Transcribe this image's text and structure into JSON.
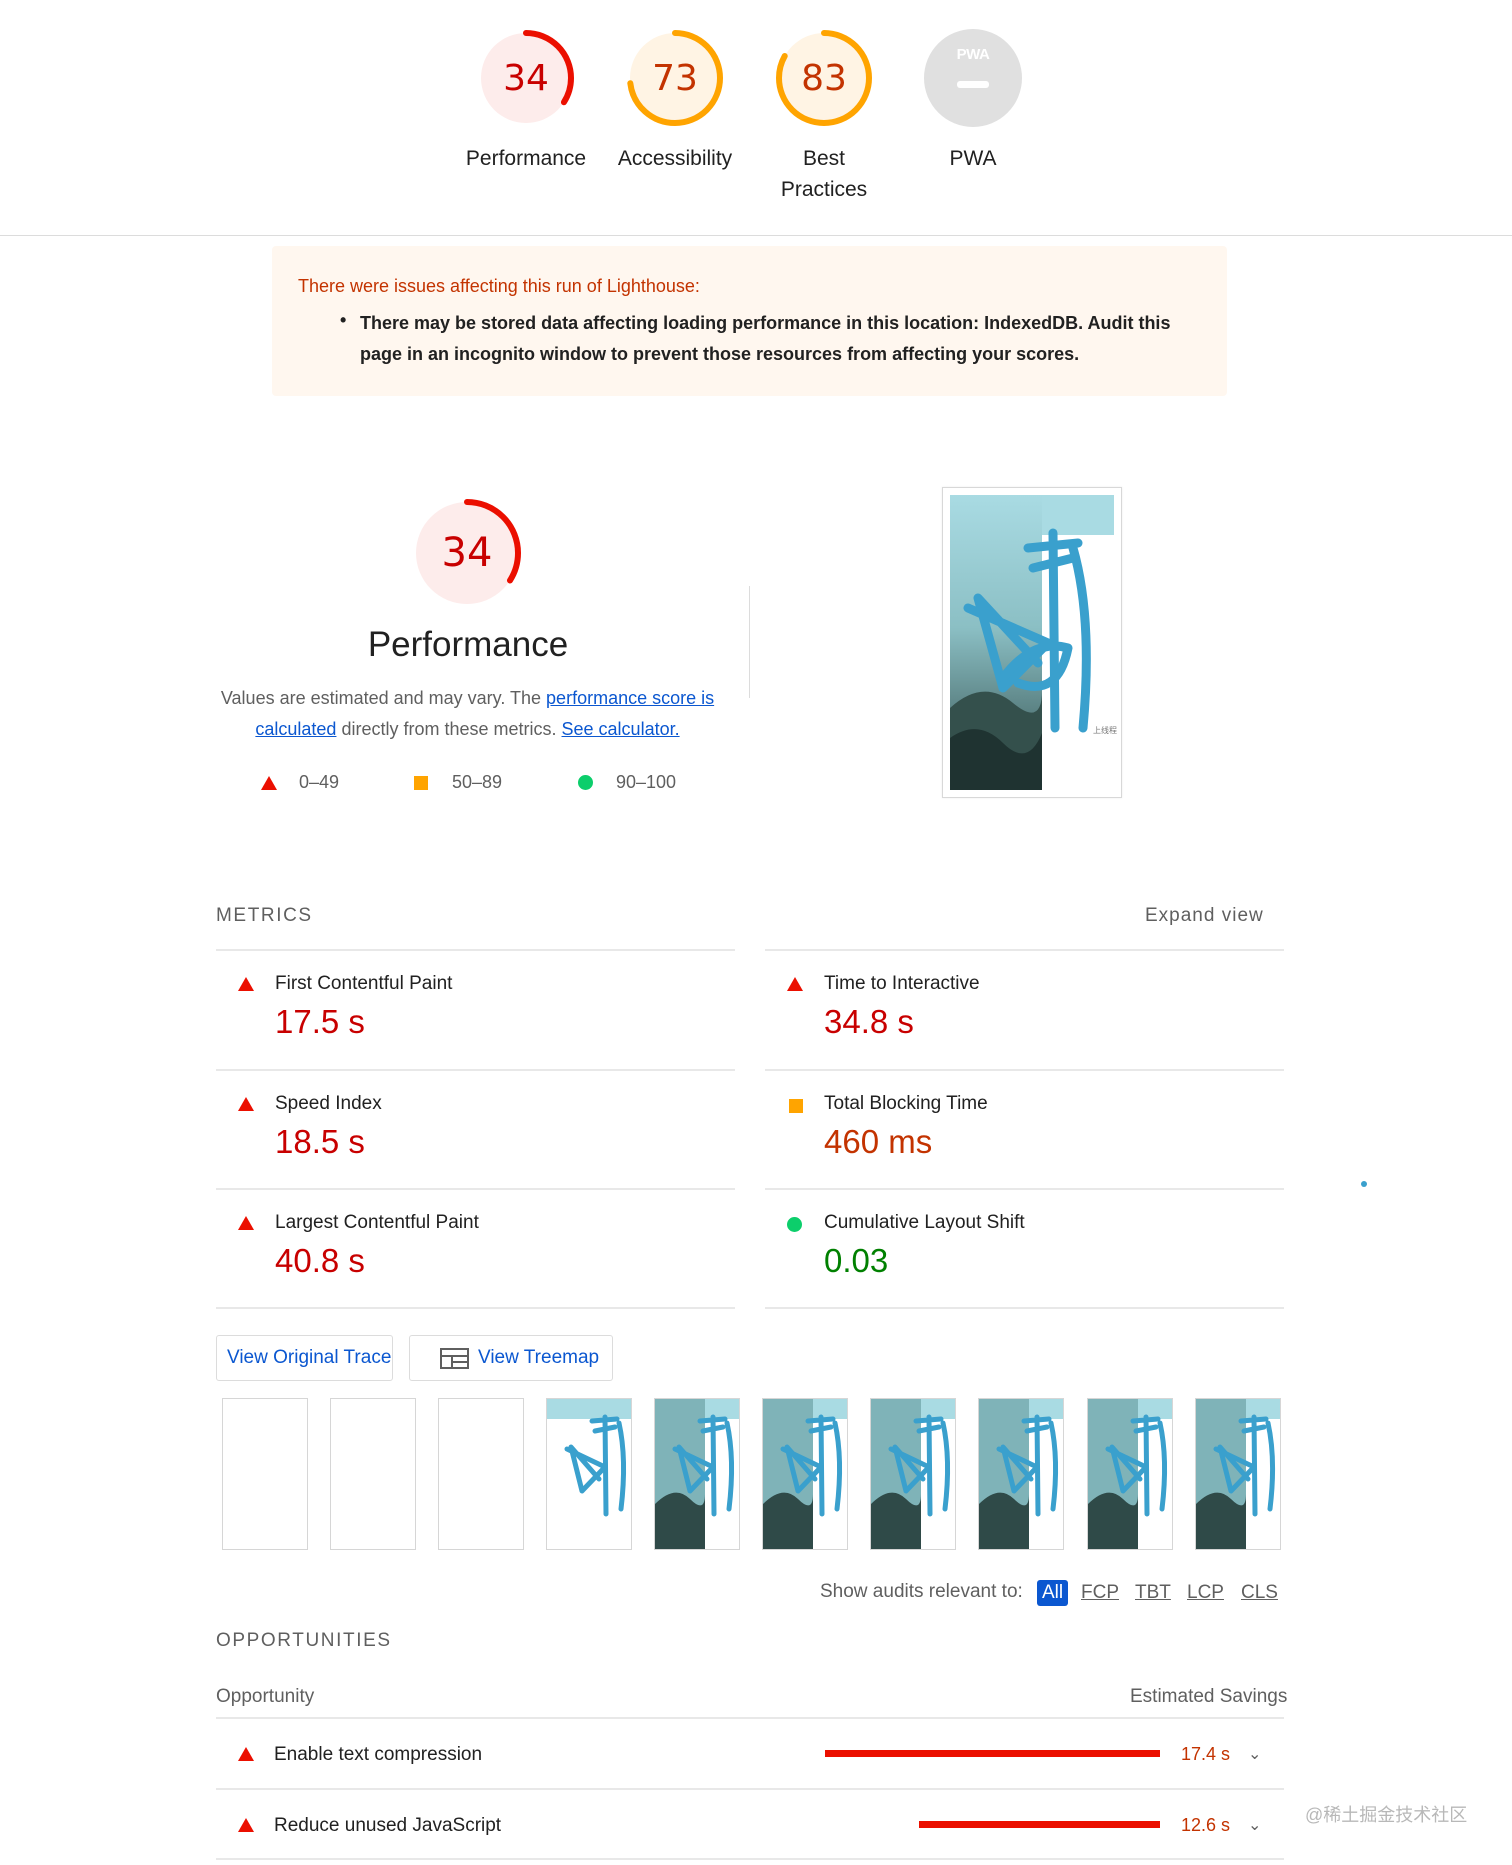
{
  "scores": [
    {
      "value": "34",
      "label": "Performance",
      "fraction": 0.34,
      "status": "fail"
    },
    {
      "value": "73",
      "label": "Accessibility",
      "fraction": 0.73,
      "status": "average"
    },
    {
      "value": "83",
      "label": "Best Practices",
      "label_line1": "Best",
      "label_line2": "Practices",
      "fraction": 0.83,
      "status": "average"
    },
    {
      "value": "",
      "label": "PWA",
      "badge": "PWA",
      "status": "na"
    }
  ],
  "colors": {
    "fail": "#eb0f00",
    "fail_text": "#c80000",
    "fail_bg": "#fdeceb",
    "average": "#ffa400",
    "average_text": "#c33300",
    "average_bg": "#fff4e4",
    "pass": "#0cce6b",
    "pass_text": "#008000",
    "link": "#0b57d0",
    "na_bg": "#e0e0e0"
  },
  "warning": {
    "title": "There were issues affecting this run of Lighthouse:",
    "item": "There may be stored data affecting loading performance in this location: IndexedDB. Audit this page in an incognito window to prevent those resources from affecting your scores."
  },
  "performance": {
    "score": "34",
    "fraction": 0.34,
    "title": "Performance",
    "desc_prefix": "Values are estimated and may vary. The ",
    "desc_link1": "performance score is calculated",
    "desc_mid": " directly from these metrics. ",
    "desc_link2": "See calculator.",
    "legend": {
      "fail": "0–49",
      "average": "50–89",
      "pass": "90–100"
    }
  },
  "metrics": {
    "heading": "METRICS",
    "expand_label": "Expand view",
    "items": [
      {
        "name": "First Contentful Paint",
        "value": "17.5 s",
        "status": "fail"
      },
      {
        "name": "Time to Interactive",
        "value": "34.8 s",
        "status": "fail"
      },
      {
        "name": "Speed Index",
        "value": "18.5 s",
        "status": "fail"
      },
      {
        "name": "Total Blocking Time",
        "value": "460 ms",
        "status": "average"
      },
      {
        "name": "Largest Contentful Paint",
        "value": "40.8 s",
        "status": "fail"
      },
      {
        "name": "Cumulative Layout Shift",
        "value": "0.03",
        "status": "pass"
      }
    ]
  },
  "buttons": {
    "view_trace": "View Original Trace",
    "view_treemap": "View Treemap"
  },
  "filter": {
    "label": "Show audits relevant to:",
    "options": [
      "All",
      "FCP",
      "TBT",
      "LCP",
      "CLS"
    ]
  },
  "opportunities": {
    "heading": "OPPORTUNITIES",
    "col_opportunity": "Opportunity",
    "col_savings": "Estimated Savings",
    "items": [
      {
        "name": "Enable text compression",
        "savings": "17.4 s",
        "fraction": 1.0
      },
      {
        "name": "Reduce unused JavaScript",
        "savings": "12.6 s",
        "fraction": 0.72
      }
    ]
  },
  "screenshot_caption": "上线程",
  "watermark": "@稀土掘金技术社区"
}
